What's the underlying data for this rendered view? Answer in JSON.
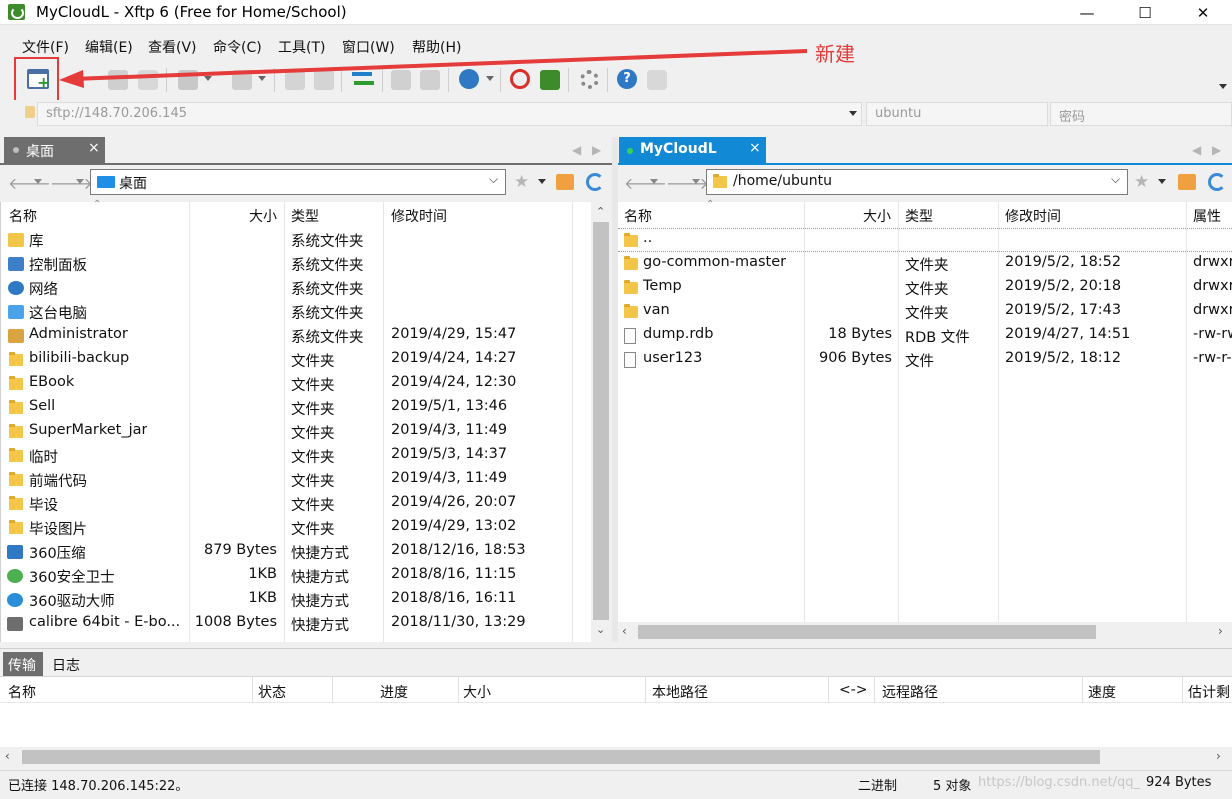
{
  "window": {
    "title": "MyCloudL - Xftp 6 (Free for Home/School)",
    "minimize": "—",
    "maximize": "☐",
    "close": "✕"
  },
  "menu": [
    "文件(F)",
    "编辑(E)",
    "查看(V)",
    "命令(C)",
    "工具(T)",
    "窗口(W)",
    "帮助(H)"
  ],
  "annotation": {
    "label": "新建",
    "color": "#e53b3b"
  },
  "address": {
    "host": "sftp://148.70.206.145",
    "user": "ubuntu",
    "password_placeholder": "密码"
  },
  "left_pane": {
    "tab_label": "桌面",
    "tab_close": "×",
    "path": "桌面",
    "columns": [
      "名称",
      "大小",
      "类型",
      "修改时间"
    ],
    "rows": [
      {
        "name": "库",
        "size": "",
        "type": "系统文件夹",
        "modified": "",
        "icon": "library-icon"
      },
      {
        "name": "控制面板",
        "size": "",
        "type": "系统文件夹",
        "modified": "",
        "icon": "control-panel-icon"
      },
      {
        "name": "网络",
        "size": "",
        "type": "系统文件夹",
        "modified": "",
        "icon": "network-icon"
      },
      {
        "name": "这台电脑",
        "size": "",
        "type": "系统文件夹",
        "modified": "",
        "icon": "computer-icon"
      },
      {
        "name": "Administrator",
        "size": "",
        "type": "系统文件夹",
        "modified": "2019/4/29, 15:47",
        "icon": "user-folder-icon"
      },
      {
        "name": "bilibili-backup",
        "size": "",
        "type": "文件夹",
        "modified": "2019/4/24, 14:27",
        "icon": "folder-icon"
      },
      {
        "name": "EBook",
        "size": "",
        "type": "文件夹",
        "modified": "2019/4/24, 12:30",
        "icon": "folder-icon"
      },
      {
        "name": "Sell",
        "size": "",
        "type": "文件夹",
        "modified": "2019/5/1, 13:46",
        "icon": "folder-icon"
      },
      {
        "name": "SuperMarket_jar",
        "size": "",
        "type": "文件夹",
        "modified": "2019/4/3, 11:49",
        "icon": "folder-icon"
      },
      {
        "name": "临时",
        "size": "",
        "type": "文件夹",
        "modified": "2019/5/3, 14:37",
        "icon": "folder-icon"
      },
      {
        "name": "前端代码",
        "size": "",
        "type": "文件夹",
        "modified": "2019/4/3, 11:49",
        "icon": "folder-icon"
      },
      {
        "name": "毕设",
        "size": "",
        "type": "文件夹",
        "modified": "2019/4/26, 20:07",
        "icon": "folder-icon"
      },
      {
        "name": "毕设图片",
        "size": "",
        "type": "文件夹",
        "modified": "2019/4/29, 13:02",
        "icon": "folder-icon"
      },
      {
        "name": "360压缩",
        "size": "879 Bytes",
        "type": "快捷方式",
        "modified": "2018/12/16, 18:53",
        "icon": "shortcut-360zip-icon"
      },
      {
        "name": "360安全卫士",
        "size": "1KB",
        "type": "快捷方式",
        "modified": "2018/8/16, 11:15",
        "icon": "shortcut-360safe-icon"
      },
      {
        "name": "360驱动大师",
        "size": "1KB",
        "type": "快捷方式",
        "modified": "2018/8/16, 16:11",
        "icon": "shortcut-360driver-icon"
      },
      {
        "name": "calibre 64bit - E-bo...",
        "size": "1008 Bytes",
        "type": "快捷方式",
        "modified": "2018/11/30, 13:29",
        "icon": "shortcut-calibre-icon"
      }
    ]
  },
  "right_pane": {
    "tab_label": "MyCloudL",
    "tab_close": "×",
    "path": "/home/ubuntu",
    "columns": [
      "名称",
      "大小",
      "类型",
      "修改时间",
      "属性"
    ],
    "rows": [
      {
        "name": "..",
        "size": "",
        "type": "",
        "modified": "",
        "attr": "",
        "icon": "folder-icon"
      },
      {
        "name": "go-common-master",
        "size": "",
        "type": "文件夹",
        "modified": "2019/5/2, 18:52",
        "attr": "drwxr",
        "icon": "folder-icon"
      },
      {
        "name": "Temp",
        "size": "",
        "type": "文件夹",
        "modified": "2019/5/2, 20:18",
        "attr": "drwxr",
        "icon": "folder-icon"
      },
      {
        "name": "van",
        "size": "",
        "type": "文件夹",
        "modified": "2019/5/2, 17:43",
        "attr": "drwxr",
        "icon": "folder-icon"
      },
      {
        "name": "dump.rdb",
        "size": "18 Bytes",
        "type": "RDB 文件",
        "modified": "2019/4/27, 14:51",
        "attr": "-rw-rw",
        "icon": "file-icon"
      },
      {
        "name": "user123",
        "size": "906 Bytes",
        "type": "文件",
        "modified": "2019/5/2, 18:12",
        "attr": "-rw-r-",
        "icon": "file-icon"
      }
    ]
  },
  "transfer_panel": {
    "tabs": [
      "传输",
      "日志"
    ],
    "columns": [
      "名称",
      "状态",
      "进度",
      "大小",
      "本地路径",
      "<->",
      "远程路径",
      "速度",
      "估计剩"
    ]
  },
  "status": {
    "connection": "已连接 148.70.206.145:22。",
    "mode": "二进制",
    "objects": "5 对象",
    "size": "924 Bytes",
    "watermark": "https://blog.csdn.net/qq_"
  },
  "colors": {
    "accent_tab": "#1289d4",
    "inactive_tab": "#6e6e6e",
    "annotation_red": "#e53b3b",
    "folder_yellow": "#f3c649"
  }
}
